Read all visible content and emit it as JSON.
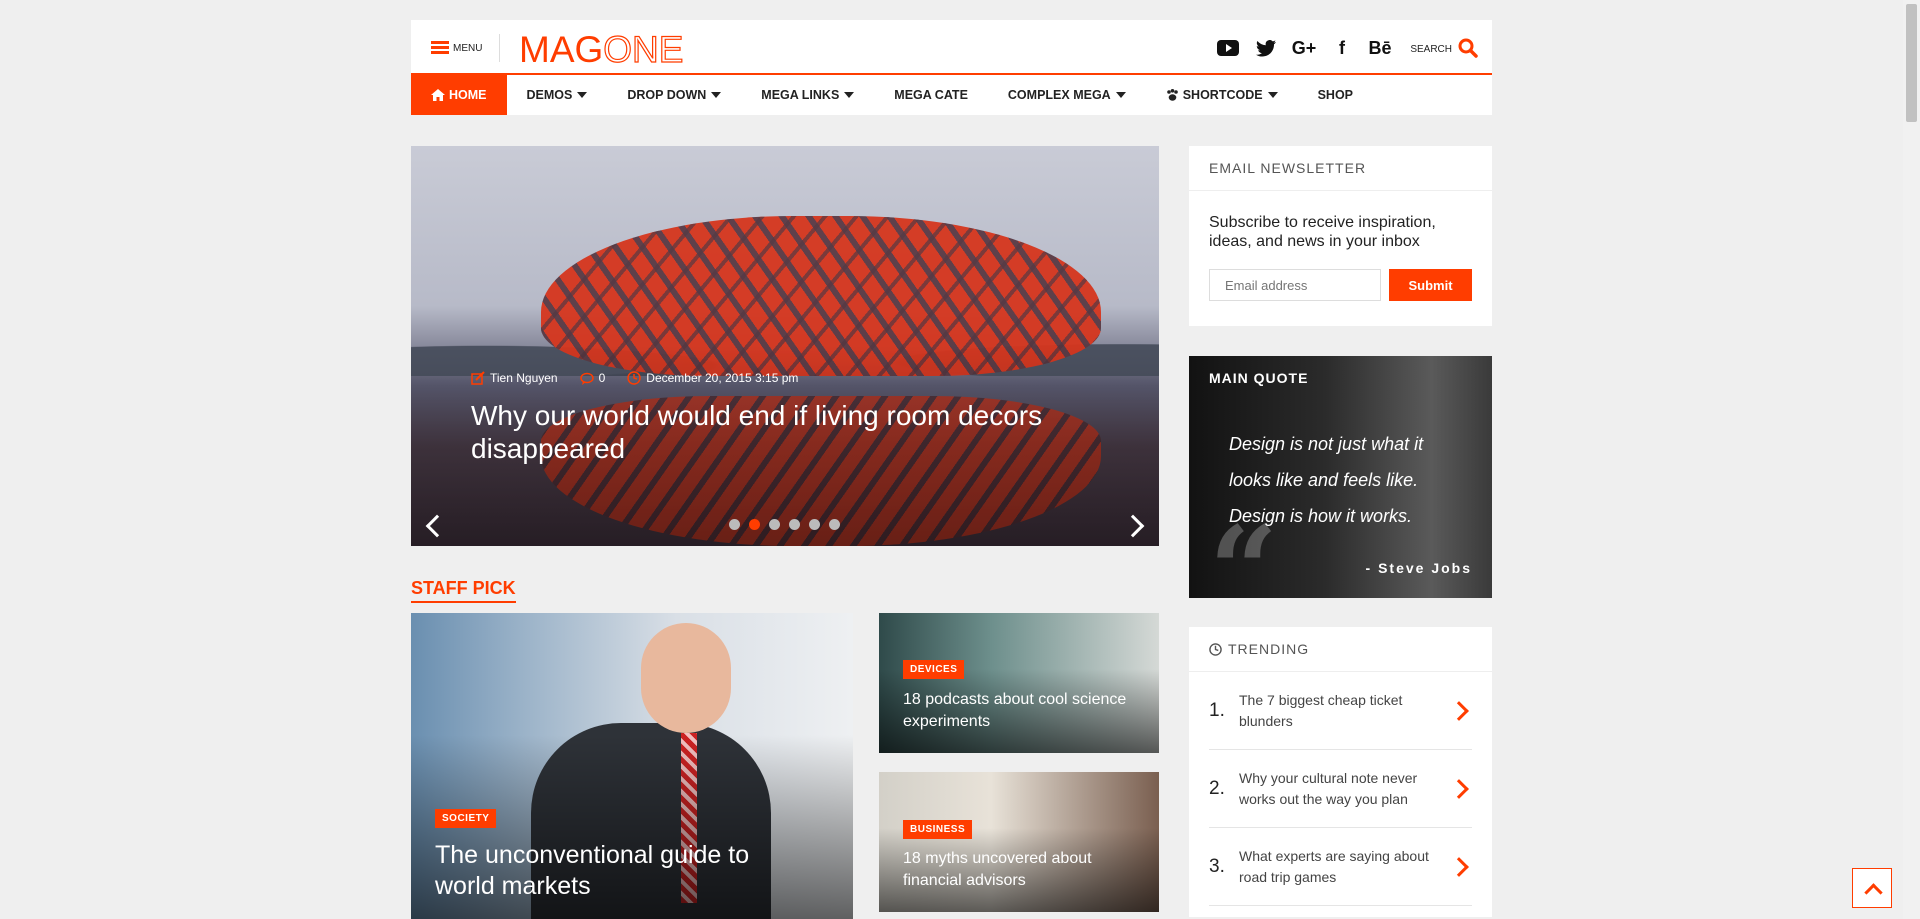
{
  "header": {
    "menu_label": "MENU",
    "logo_part1": "MAG",
    "logo_part2": "ONE",
    "social": [
      "youtube-icon",
      "twitter-icon",
      "google-plus-icon",
      "facebook-icon",
      "behance-icon"
    ],
    "behance_text": "Bē",
    "google_text": "G+",
    "facebook_text": "f",
    "search_label": "SEARCH"
  },
  "nav": {
    "items": [
      {
        "label": "HOME",
        "active": true,
        "dropdown": false
      },
      {
        "label": "DEMOS",
        "dropdown": true
      },
      {
        "label": "DROP DOWN",
        "dropdown": true
      },
      {
        "label": "MEGA LINKS",
        "dropdown": true
      },
      {
        "label": "MEGA CATE",
        "dropdown": false
      },
      {
        "label": "COMPLEX MEGA",
        "dropdown": true
      },
      {
        "label": "SHORTCODE",
        "dropdown": true
      },
      {
        "label": "SHOP",
        "dropdown": false
      }
    ]
  },
  "slider": {
    "author": "Tien Nguyen",
    "comments": "0",
    "date": "December 20, 2015 3:15 pm",
    "title": "Why our world would end if living room decors disappeared",
    "active_dot": 2,
    "dot_count": 6
  },
  "staff_pick": {
    "title": "STAFF PICK",
    "big": {
      "badge": "SOCIETY",
      "title": "The unconventional guide to world markets"
    },
    "small": [
      {
        "badge": "DEVICES",
        "title": "18 podcasts about cool science experiments"
      },
      {
        "badge": "BUSINESS",
        "title": "18 myths uncovered about financial advisors"
      }
    ]
  },
  "newsletter": {
    "title": "EMAIL NEWSLETTER",
    "text": "Subscribe to receive inspiration, ideas, and news in your inbox",
    "placeholder": "Email address",
    "submit": "Submit"
  },
  "quote": {
    "title": "MAIN QUOTE",
    "text": "Design is not just what it looks like and feels like. Design is how it works.",
    "author": "- Steve Jobs"
  },
  "trending": {
    "title": "TRENDING",
    "items": [
      {
        "num": "1.",
        "text": "The 7 biggest cheap ticket blunders"
      },
      {
        "num": "2.",
        "text": "Why your cultural note never works out the way you plan"
      },
      {
        "num": "3.",
        "text": "What experts are saying about road trip games"
      }
    ]
  },
  "colors": {
    "accent": "#ff3d00"
  }
}
